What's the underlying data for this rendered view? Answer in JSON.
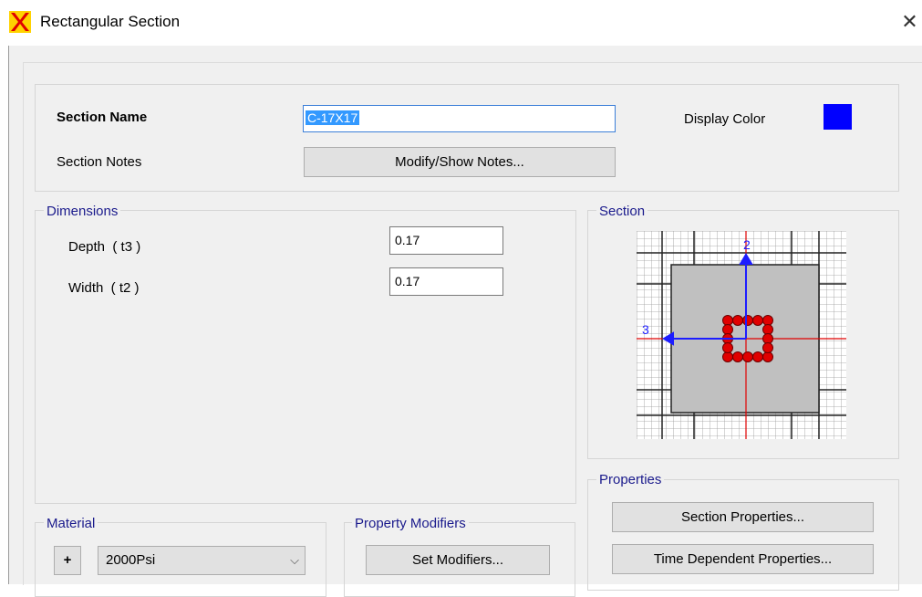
{
  "window": {
    "title": "Rectangular Section",
    "close_glyph": "✕"
  },
  "section_name": {
    "label": "Section Name",
    "value": "C-17X17"
  },
  "section_notes": {
    "label": "Section Notes",
    "button": "Modify/Show Notes..."
  },
  "display_color": {
    "label": "Display Color",
    "color": "#0000ff"
  },
  "dimensions": {
    "title": "Dimensions",
    "depth_label": "Depth  ( t3 )",
    "depth_value": "0.17",
    "width_label": "Width  ( t2 )",
    "width_value": "0.17"
  },
  "section_preview": {
    "title": "Section",
    "axis_2": "2",
    "axis_3": "3"
  },
  "properties": {
    "title": "Properties",
    "section_properties_button": "Section Properties...",
    "time_dependent_button": "Time Dependent Properties..."
  },
  "material": {
    "title": "Material",
    "add_button": "+",
    "selected": "2000Psi"
  },
  "property_modifiers": {
    "title": "Property Modifiers",
    "button": "Set Modifiers..."
  }
}
